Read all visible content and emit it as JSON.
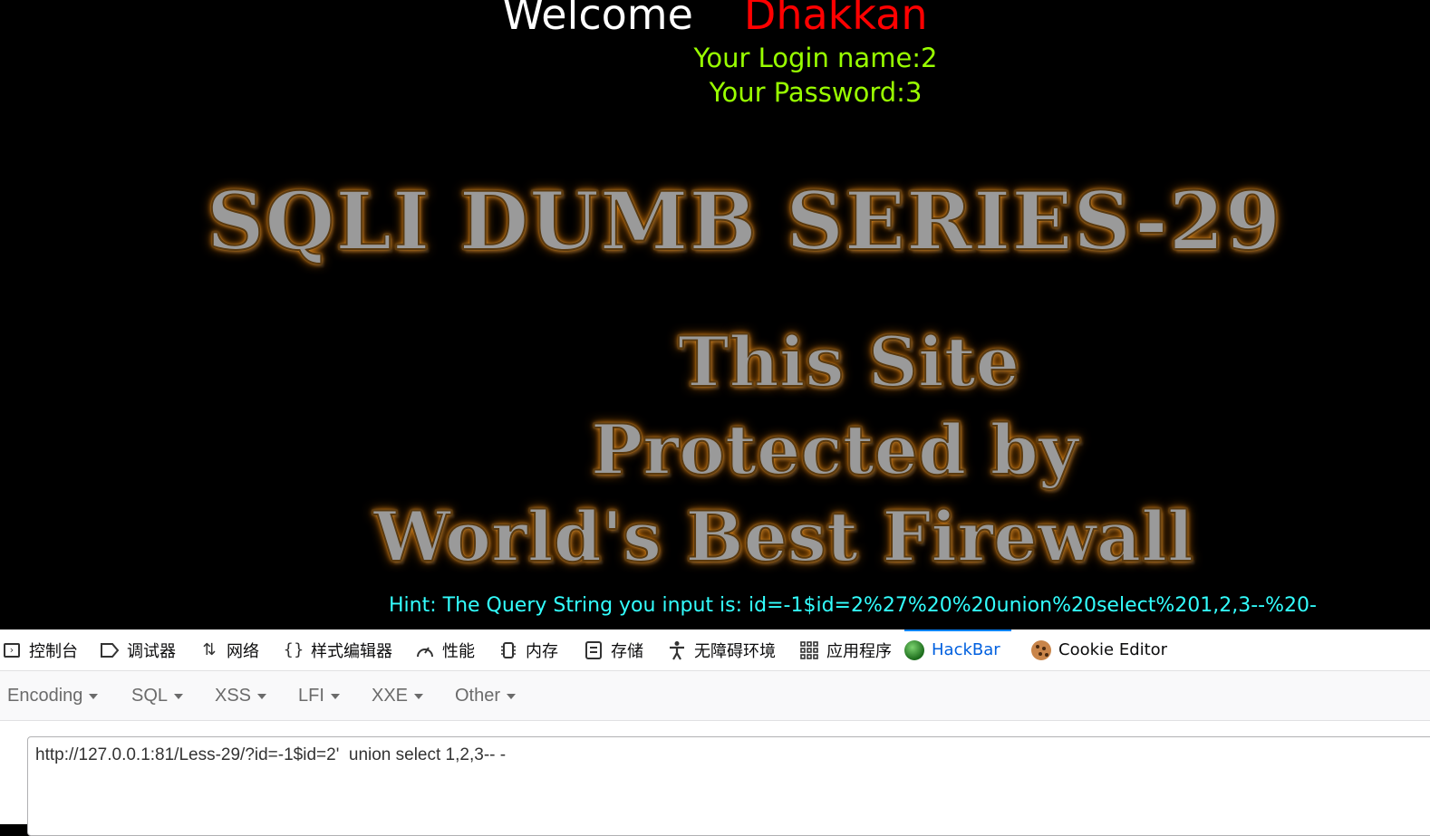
{
  "page": {
    "welcome_label": "Welcome",
    "welcome_name": "Dhakkan",
    "login_name": "Your Login name:2",
    "password": "Your Password:3",
    "banner_title": "SQLI DUMB SERIES-29",
    "banner_line1": "This Site",
    "banner_line2": "Protected by",
    "banner_line3": "World's Best Firewall",
    "hint": "Hint: The Query String you input is: id=-1$id=2%27%20%20union%20select%201,2,3--%20-"
  },
  "devtools": {
    "tabs": [
      {
        "label": "控制台",
        "icon": "console-icon"
      },
      {
        "label": "调试器",
        "icon": "debugger-icon"
      },
      {
        "label": "网络",
        "icon": "network-icon"
      },
      {
        "label": "样式编辑器",
        "icon": "style-editor-icon"
      },
      {
        "label": "性能",
        "icon": "performance-icon"
      },
      {
        "label": "内存",
        "icon": "memory-icon"
      },
      {
        "label": "存储",
        "icon": "storage-icon"
      },
      {
        "label": "无障碍环境",
        "icon": "accessibility-icon"
      },
      {
        "label": "应用程序",
        "icon": "application-icon"
      },
      {
        "label": "HackBar",
        "icon": "hackbar-icon",
        "active": true
      },
      {
        "label": "Cookie Editor",
        "icon": "cookie-icon"
      }
    ],
    "hackbar_menus": [
      "Encoding",
      "SQL",
      "XSS",
      "LFI",
      "XXE",
      "Other"
    ],
    "url_value": "http://127.0.0.1:81/Less-29/?id=-1$id=2'  union select 1,2,3-- -"
  },
  "colors": {
    "welcome": "#ffffff",
    "name": "#ff0000",
    "login": "#99ff00",
    "hint": "#33ffff",
    "active_tab": "#0060df"
  }
}
